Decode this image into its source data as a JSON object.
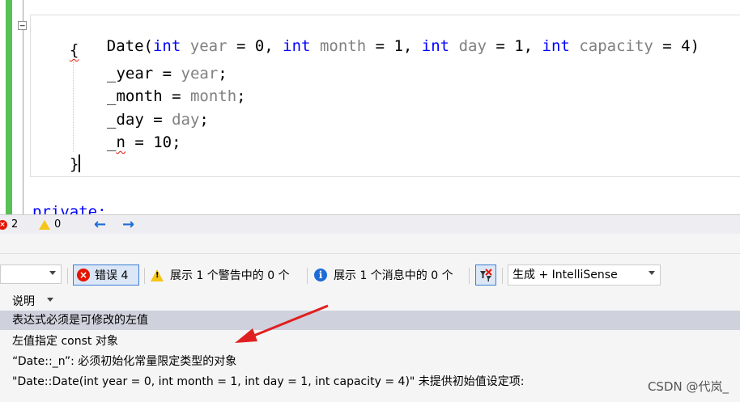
{
  "editor": {
    "fold_symbol": "−",
    "line1": {
      "name": "Date(",
      "kw1": "int",
      "p1": "year",
      "a1": " = 0, ",
      "kw2": "int",
      "p2": "month",
      "a2": " = 1, ",
      "kw3": "int",
      "p3": "day",
      "a3": " = 1, ",
      "kw4": "int",
      "p4": "capacity",
      "a4": " = 4)"
    },
    "brace_open": "{",
    "assign1": {
      "member": "_year",
      "op": " = ",
      "value": "year",
      "end": ";"
    },
    "assign2": {
      "member": "_month",
      "op": " = ",
      "value": "month",
      "end": ";"
    },
    "assign3": {
      "member": "_day",
      "op": " = ",
      "value": "day",
      "end": ";"
    },
    "assign4": {
      "member_prefix": "_",
      "member_err": "n",
      "op": " = ",
      "value": "10",
      "end": ";"
    },
    "brace_close": "}",
    "private_line": "private:"
  },
  "status": {
    "error_count": "2",
    "warning_count": "0",
    "back_arrow": "←",
    "forward_arrow": "→"
  },
  "toolbar": {
    "errors_label": "错误 4",
    "warnings_label": "展示 1 个警告中的 0 个",
    "messages_label": "展示 1 个消息中的 0 个",
    "build_scope": "生成 + IntelliSense"
  },
  "list": {
    "column_description": "说明",
    "rows": [
      "表达式必须是可修改的左值",
      "左值指定 const 对象",
      "“Date::_n”: 必须初始化常量限定类型的对象",
      "\"Date::Date(int year = 0, int month = 1, int day = 1, int capacity = 4)\" 未提供初始值设定项:"
    ]
  },
  "watermark": "CSDN @代岚_",
  "colors": {
    "keyword": "#0000ff",
    "parameter": "#808080",
    "error": "#e51400",
    "selection": "#cfd2dd",
    "arrow": "#e02020"
  },
  "icons": {
    "error": "error-icon",
    "warning": "warning-icon",
    "info": "info-icon",
    "filter": "filter-icon"
  }
}
